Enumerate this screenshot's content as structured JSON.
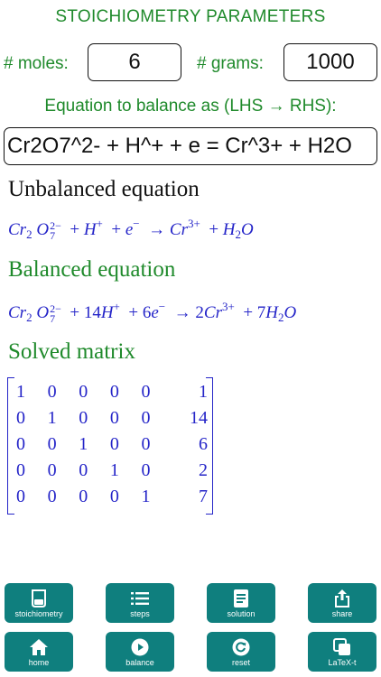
{
  "header": {
    "title": "STOICHIOMETRY PARAMETERS"
  },
  "params": {
    "moles_label": "# moles:",
    "moles_value": "6",
    "grams_label": "# grams:",
    "grams_value": "1000"
  },
  "equation": {
    "label": "Equation to balance as (LHS → RHS):",
    "input": "Cr2O7^2- + H^+ + e = Cr^3+ + H2O"
  },
  "sections": {
    "unbalanced_title": "Unbalanced equation",
    "balanced_title": "Balanced equation",
    "matrix_title": "Solved matrix"
  },
  "unbalanced": {
    "cr": "Cr",
    "two": "2",
    "o": "O",
    "ch1": "2−",
    "sub7": "7",
    "plus1": "+",
    "h": "H",
    "hplus": "+",
    "plus2": "+",
    "e": "e",
    "eminus": "−",
    "arrow": "→",
    "cr2": "Cr",
    "cr3": "3+",
    "plus3": "+",
    "h2": "H",
    "h2sub": "2",
    "o2": "O"
  },
  "balanced": {
    "cr": "Cr",
    "two": "2",
    "o": "O",
    "ch1": "2−",
    "sub7": "7",
    "plus1": "+",
    "c14": "14",
    "h": "H",
    "hplus": "+",
    "plus2": "+",
    "c6": "6",
    "e": "e",
    "eminus": "−",
    "arrow": "→",
    "c2": "2",
    "cr2": "Cr",
    "cr3": "3+",
    "plus3": "+",
    "c7": "7",
    "h2": "H",
    "h2sub": "2",
    "o2": "O"
  },
  "matrix": {
    "rows": [
      [
        "1",
        "0",
        "0",
        "0",
        "0",
        "1"
      ],
      [
        "0",
        "1",
        "0",
        "0",
        "0",
        "14"
      ],
      [
        "0",
        "0",
        "1",
        "0",
        "0",
        "6"
      ],
      [
        "0",
        "0",
        "0",
        "1",
        "0",
        "2"
      ],
      [
        "0",
        "0",
        "0",
        "0",
        "1",
        "7"
      ]
    ]
  },
  "toolbar": {
    "stoichiometry": "stoichiometry",
    "steps": "steps",
    "solution": "solution",
    "share": "share",
    "home": "home",
    "balance": "balance",
    "reset": "reset",
    "latex": "LaTeX-t"
  },
  "colors": {
    "label_green": "#1f8a2b",
    "math_blue": "#2424c8",
    "button_teal": "#0f7f7e"
  },
  "icons": {
    "stoichiometry": "beaker-icon",
    "steps": "list-icon",
    "solution": "document-icon",
    "share": "share-icon",
    "home": "home-icon",
    "balance": "play-icon",
    "reset": "reset-icon",
    "latex": "copy-icon"
  }
}
